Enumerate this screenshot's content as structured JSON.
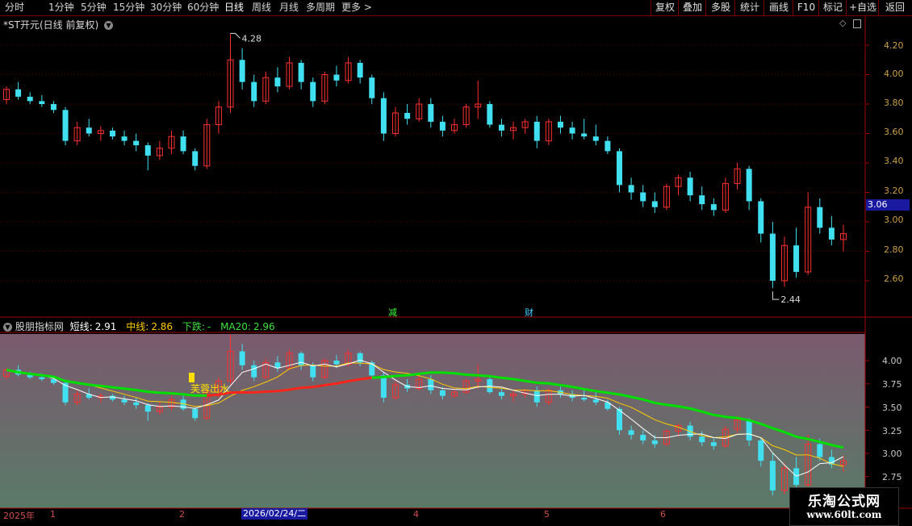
{
  "toolbar": {
    "periods": [
      "分时",
      "1分钟",
      "5分钟",
      "15分钟",
      "30分钟",
      "60分钟",
      "日线",
      "周线",
      "月线",
      "多周期",
      "更多 >"
    ],
    "active_period": "日线",
    "right_buttons": [
      "复权",
      "叠加",
      "多股",
      "统计",
      "画线",
      "F10",
      "标记",
      "+自选",
      "返回"
    ]
  },
  "main_chart": {
    "title": "*ST开元(日线 前复权)",
    "high_label": "4.28",
    "low_label": "2.44",
    "price_tag": "3.06",
    "y_ticks": [
      "4.20",
      "4.00",
      "3.80",
      "3.60",
      "3.40",
      "3.20",
      "3.00",
      "2.80",
      "2.60"
    ],
    "markers": [
      {
        "text": "减",
        "color": "#40ff40"
      },
      {
        "text": "财",
        "color": "#40d0ff"
      }
    ]
  },
  "indicator": {
    "name": "股朋指标网",
    "short_label": "短线:",
    "short_value": "2.91",
    "mid_label": "中线:",
    "mid_value": "2.86",
    "down_label": "下跌:",
    "down_value": "-",
    "ma20_label": "MA20:",
    "ma20_value": "2.96",
    "signal_text": "芙蓉出水",
    "y_ticks": [
      "4.00",
      "3.75",
      "3.50",
      "3.25",
      "3.00",
      "2.75"
    ]
  },
  "x_axis": {
    "year_label": "2025年",
    "month_labels": [
      "1",
      "2",
      "4",
      "5",
      "6"
    ],
    "cursor_date": "2026/02/24/二"
  },
  "watermark": {
    "line1": "乐淘公式网",
    "line2": "www.60lt.com"
  },
  "colors": {
    "up": "#ff3030",
    "down": "#40e0f0",
    "ma20": "#00e000",
    "mid": "#ffcc00",
    "short": "#ffffff",
    "frame": "#a00000"
  },
  "chart_data": {
    "type": "candlestick",
    "description_units": "price (CNY)",
    "ylim_main": [
      2.45,
      4.3
    ],
    "ylim_indicator": [
      2.6,
      4.2
    ],
    "candles": [
      [
        3.83,
        3.92,
        3.8,
        3.9
      ],
      [
        3.9,
        3.95,
        3.83,
        3.85
      ],
      [
        3.85,
        3.88,
        3.8,
        3.82
      ],
      [
        3.82,
        3.86,
        3.78,
        3.8
      ],
      [
        3.8,
        3.82,
        3.74,
        3.76
      ],
      [
        3.76,
        3.78,
        3.52,
        3.55
      ],
      [
        3.55,
        3.68,
        3.52,
        3.64
      ],
      [
        3.64,
        3.7,
        3.58,
        3.6
      ],
      [
        3.6,
        3.65,
        3.55,
        3.62
      ],
      [
        3.62,
        3.64,
        3.56,
        3.58
      ],
      [
        3.58,
        3.62,
        3.52,
        3.55
      ],
      [
        3.55,
        3.6,
        3.48,
        3.52
      ],
      [
        3.52,
        3.54,
        3.35,
        3.45
      ],
      [
        3.45,
        3.55,
        3.42,
        3.5
      ],
      [
        3.5,
        3.62,
        3.46,
        3.58
      ],
      [
        3.58,
        3.62,
        3.46,
        3.48
      ],
      [
        3.48,
        3.5,
        3.35,
        3.38
      ],
      [
        3.38,
        3.7,
        3.36,
        3.66
      ],
      [
        3.66,
        3.82,
        3.6,
        3.78
      ],
      [
        3.78,
        4.28,
        3.74,
        4.1
      ],
      [
        4.1,
        4.18,
        3.9,
        3.95
      ],
      [
        3.95,
        4.0,
        3.78,
        3.82
      ],
      [
        3.82,
        4.02,
        3.8,
        3.98
      ],
      [
        3.98,
        4.05,
        3.88,
        3.92
      ],
      [
        3.92,
        4.12,
        3.9,
        4.08
      ],
      [
        4.08,
        4.1,
        3.9,
        3.95
      ],
      [
        3.95,
        3.98,
        3.78,
        3.82
      ],
      [
        3.82,
        4.02,
        3.8,
        4.0
      ],
      [
        4.0,
        4.06,
        3.92,
        3.96
      ],
      [
        3.96,
        4.12,
        3.94,
        4.08
      ],
      [
        4.08,
        4.1,
        3.94,
        3.98
      ],
      [
        3.98,
        4.0,
        3.8,
        3.84
      ],
      [
        3.84,
        3.88,
        3.55,
        3.6
      ],
      [
        3.6,
        3.78,
        3.58,
        3.74
      ],
      [
        3.74,
        3.8,
        3.66,
        3.7
      ],
      [
        3.7,
        3.84,
        3.68,
        3.8
      ],
      [
        3.8,
        3.84,
        3.64,
        3.68
      ],
      [
        3.68,
        3.72,
        3.58,
        3.62
      ],
      [
        3.62,
        3.7,
        3.6,
        3.66
      ],
      [
        3.66,
        3.8,
        3.64,
        3.78
      ],
      [
        3.78,
        3.96,
        3.7,
        3.8
      ],
      [
        3.8,
        3.82,
        3.64,
        3.66
      ],
      [
        3.66,
        3.7,
        3.58,
        3.62
      ],
      [
        3.62,
        3.68,
        3.56,
        3.64
      ],
      [
        3.64,
        3.7,
        3.6,
        3.68
      ],
      [
        3.68,
        3.72,
        3.5,
        3.55
      ],
      [
        3.55,
        3.7,
        3.52,
        3.68
      ],
      [
        3.68,
        3.72,
        3.6,
        3.64
      ],
      [
        3.64,
        3.68,
        3.56,
        3.6
      ],
      [
        3.6,
        3.7,
        3.56,
        3.58
      ],
      [
        3.58,
        3.66,
        3.52,
        3.55
      ],
      [
        3.55,
        3.58,
        3.46,
        3.48
      ],
      [
        3.48,
        3.5,
        3.2,
        3.25
      ],
      [
        3.25,
        3.3,
        3.15,
        3.2
      ],
      [
        3.2,
        3.25,
        3.1,
        3.14
      ],
      [
        3.14,
        3.2,
        3.06,
        3.1
      ],
      [
        3.1,
        3.26,
        3.08,
        3.24
      ],
      [
        3.24,
        3.32,
        3.18,
        3.3
      ],
      [
        3.3,
        3.34,
        3.14,
        3.18
      ],
      [
        3.18,
        3.24,
        3.08,
        3.12
      ],
      [
        3.12,
        3.16,
        3.04,
        3.08
      ],
      [
        3.08,
        3.3,
        3.06,
        3.26
      ],
      [
        3.26,
        3.4,
        3.22,
        3.36
      ],
      [
        3.36,
        3.38,
        3.08,
        3.14
      ],
      [
        3.14,
        3.16,
        2.86,
        2.92
      ],
      [
        2.92,
        3.0,
        2.55,
        2.6
      ],
      [
        2.6,
        2.9,
        2.56,
        2.84
      ],
      [
        2.84,
        2.96,
        2.62,
        2.66
      ],
      [
        2.66,
        3.2,
        2.64,
        3.1
      ],
      [
        3.1,
        3.16,
        2.92,
        2.96
      ],
      [
        2.96,
        3.04,
        2.84,
        2.88
      ],
      [
        2.88,
        2.98,
        2.8,
        2.92
      ]
    ]
  }
}
